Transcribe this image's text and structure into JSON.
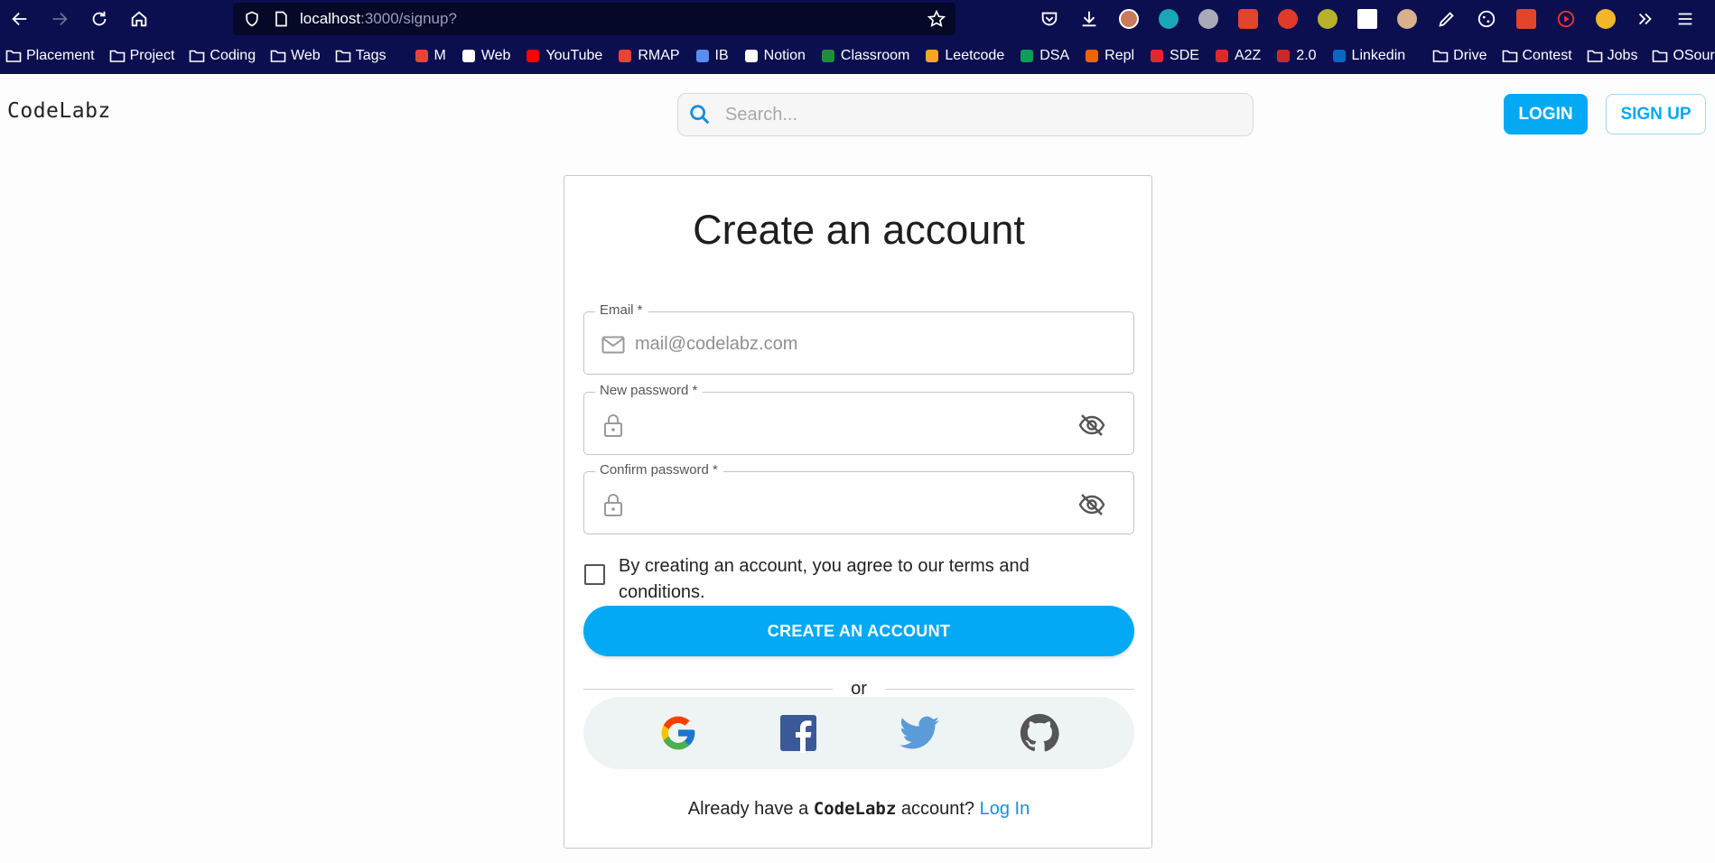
{
  "browser": {
    "url_host": "localhost",
    "url_path": ":3000/signup?",
    "bookmarks": [
      {
        "label": "Placement",
        "icon": "folder-icon"
      },
      {
        "label": "Project",
        "icon": "folder-icon"
      },
      {
        "label": "Coding",
        "icon": "folder-icon"
      },
      {
        "label": "Web",
        "icon": "folder-icon"
      },
      {
        "label": "Tags",
        "icon": "folder-icon"
      },
      {
        "label": "M",
        "icon": "gmail-icon"
      },
      {
        "label": "Web",
        "icon": "wordpress-icon"
      },
      {
        "label": "YouTube",
        "icon": "youtube-icon"
      },
      {
        "label": "RMAP",
        "icon": "gmail-icon"
      },
      {
        "label": "IB",
        "icon": "ib-icon"
      },
      {
        "label": "Notion",
        "icon": "notion-icon"
      },
      {
        "label": "Classroom",
        "icon": "classroom-icon"
      },
      {
        "label": "Leetcode",
        "icon": "leetcode-icon"
      },
      {
        "label": "DSA",
        "icon": "sheets-icon"
      },
      {
        "label": "Repl",
        "icon": "replit-icon"
      },
      {
        "label": "SDE",
        "icon": "tuf-icon"
      },
      {
        "label": "A2Z",
        "icon": "tuf-icon"
      },
      {
        "label": "2.0",
        "icon": "bird-icon"
      },
      {
        "label": "Linkedin",
        "icon": "linkedin-icon"
      },
      {
        "label": "Drive",
        "icon": "folder-icon"
      },
      {
        "label": "Contest",
        "icon": "folder-icon"
      },
      {
        "label": "Jobs",
        "icon": "folder-icon"
      },
      {
        "label": "OSource",
        "icon": "folder-icon"
      }
    ]
  },
  "header": {
    "logo": "CodeLabz",
    "search_placeholder": "Search...",
    "login_label": "LOGIN",
    "signup_label": "SIGN UP"
  },
  "signup": {
    "title": "Create an account",
    "email_label": "Email *",
    "email_placeholder": "mail@codelabz.com",
    "password_label": "New password *",
    "confirm_label": "Confirm password *",
    "terms_text": "By creating an account, you agree to our terms and conditions.",
    "create_label": "CREATE AN ACCOUNT",
    "or_text": "or",
    "social": [
      "google-icon",
      "facebook-icon",
      "twitter-icon",
      "github-icon"
    ],
    "footer_prefix": "Already have a",
    "footer_brand": "CodeLabz",
    "footer_suffix": "account?",
    "footer_link": "Log In"
  },
  "colors": {
    "accent": "#03a9f4",
    "browser_bar": "#0c0f4f",
    "link": "#1a8fd6"
  }
}
